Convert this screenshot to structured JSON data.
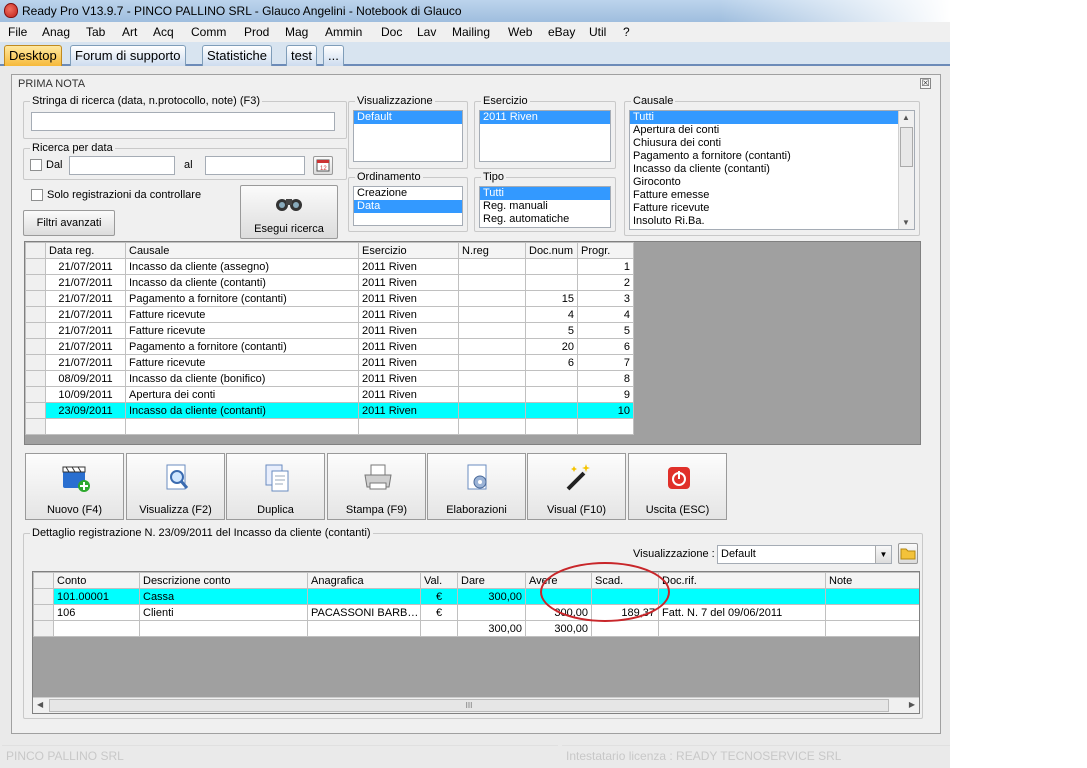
{
  "window": {
    "title": "Ready Pro V13.9.7 - PINCO PALLINO SRL - Glauco Angelini - Notebook di Glauco"
  },
  "menu": [
    "File",
    "Anag",
    "Tab",
    "Art",
    "Acq",
    "Comm",
    "Prod",
    "Mag",
    "Ammin",
    "Doc",
    "Lav",
    "Mailing",
    "Web",
    "eBay",
    "Util",
    "?"
  ],
  "tabs": [
    "Desktop",
    "Forum di supporto",
    "Statistiche",
    "test",
    "..."
  ],
  "panel": {
    "title": "PRIMA NOTA",
    "close": "☒",
    "search": {
      "label": "Stringa di ricerca (data, n.protocollo, note) (F3)",
      "value": ""
    },
    "date_search": {
      "label": "Ricerca per data",
      "from_label": "Dal",
      "to_label": "al",
      "from_value": "",
      "to_value": ""
    },
    "solo_label": "Solo registrazioni da controllare",
    "filtri_label": "Filtri avanzati",
    "esegui_label": "Esegui ricerca",
    "visualizzazione": {
      "label": "Visualizzazione",
      "items": [
        "Default"
      ]
    },
    "esercizio": {
      "label": "Esercizio",
      "items": [
        "2011 Riven"
      ]
    },
    "ordinamento": {
      "label": "Ordinamento",
      "items": [
        "Creazione",
        "Data"
      ]
    },
    "tipo": {
      "label": "Tipo",
      "items": [
        "Tutti",
        "Reg. manuali",
        "Reg. automatiche"
      ]
    },
    "causale": {
      "label": "Causale",
      "items": [
        "Tutti",
        "Apertura dei conti",
        "Chiusura dei conti",
        "Pagamento a fornitore (contanti)",
        "Incasso da cliente (contanti)",
        "Giroconto",
        "Fatture emesse",
        "Fatture ricevute",
        "Insoluto Ri.Ba."
      ]
    }
  },
  "main_grid": {
    "headers": [
      "Data reg.",
      "Causale",
      "Esercizio",
      "N.reg",
      "Doc.num",
      "Progr."
    ],
    "rows": [
      [
        "21/07/2011",
        "Incasso da cliente (assegno)",
        "2011 Riven",
        "",
        "",
        "1"
      ],
      [
        "21/07/2011",
        "Incasso da cliente (contanti)",
        "2011 Riven",
        "",
        "",
        "2"
      ],
      [
        "21/07/2011",
        "Pagamento a fornitore (contanti)",
        "2011 Riven",
        "",
        "15",
        "3"
      ],
      [
        "21/07/2011",
        "Fatture ricevute",
        "2011 Riven",
        "",
        "4",
        "4"
      ],
      [
        "21/07/2011",
        "Fatture ricevute",
        "2011 Riven",
        "",
        "5",
        "5"
      ],
      [
        "21/07/2011",
        "Pagamento a fornitore (contanti)",
        "2011 Riven",
        "",
        "20",
        "6"
      ],
      [
        "21/07/2011",
        "Fatture ricevute",
        "2011 Riven",
        "",
        "6",
        "7"
      ],
      [
        "08/09/2011",
        "Incasso da cliente (bonifico)",
        "2011 Riven",
        "",
        "",
        "8"
      ],
      [
        "10/09/2011",
        "Apertura dei conti",
        "2011 Riven",
        "",
        "",
        "9"
      ],
      [
        "23/09/2011",
        "Incasso da cliente (contanti)",
        "2011 Riven",
        "",
        "",
        "10"
      ]
    ]
  },
  "toolbar": [
    "Nuovo (F4)",
    "Visualizza (F2)",
    "Duplica",
    "Stampa (F9)",
    "Elaborazioni",
    "Visual (F10)",
    "Uscita (ESC)"
  ],
  "detail": {
    "label": "Dettaglio registrazione N. 23/09/2011 del Incasso da cliente (contanti)",
    "vis_label": "Visualizzazione :",
    "vis_value": "Default",
    "headers": [
      "Conto",
      "Descrizione conto",
      "Anagrafica",
      "Val.",
      "Dare",
      "Avere",
      "Scad.",
      "Doc.rif.",
      "Note"
    ],
    "rows": [
      [
        "101.00001",
        "Cassa",
        "",
        "€",
        "300,00",
        "",
        "",
        "",
        ""
      ],
      [
        "106",
        "Clienti",
        "PACASSONI BARB…",
        "€",
        "",
        "300,00",
        "189,37",
        "Fatt. N. 7 del 09/06/2011",
        ""
      ],
      [
        "",
        "",
        "",
        "",
        "300,00",
        "300,00",
        "",
        "",
        ""
      ]
    ],
    "scroll_glyph": "III"
  },
  "status": {
    "left": "PINCO PALLINO SRL",
    "right": "Intestatario licenza : READY TECNOSERVICE SRL"
  }
}
